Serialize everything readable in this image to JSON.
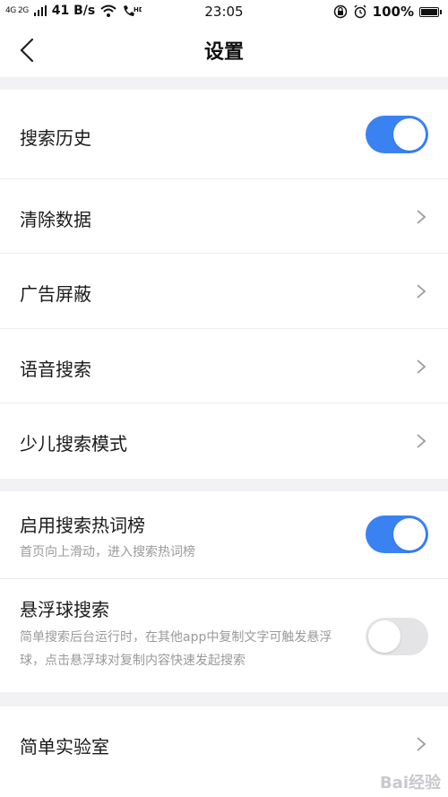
{
  "status_bar": {
    "signal_text": "4G 2G",
    "speed": "41 B/s",
    "time": "23:05",
    "battery": "100%",
    "icons": [
      "signal-icon",
      "wifi-icon",
      "hd-call-icon",
      "rotation-lock-icon",
      "alarm-icon",
      "battery-icon"
    ]
  },
  "nav": {
    "title": "设置",
    "back_icon": "chevron-left-icon"
  },
  "group1": {
    "search_history": {
      "label": "搜索历史",
      "toggle": true
    },
    "clear_data": {
      "label": "清除数据"
    },
    "ad_block": {
      "label": "广告屏蔽"
    },
    "voice_search": {
      "label": "语音搜索"
    },
    "kids_mode": {
      "label": "少儿搜索模式"
    }
  },
  "group2": {
    "hot_list": {
      "label": "启用搜索热词榜",
      "desc": "首页向上滑动，进入搜索热词榜",
      "toggle": true
    },
    "floating_ball": {
      "label": "悬浮球搜索",
      "desc": "简单搜索后台运行时，在其他app中复制文字可触发悬浮球，点击悬浮球对复制内容快速发起搜索",
      "toggle": false
    }
  },
  "group3": {
    "lab": {
      "label": "简单实验室"
    }
  },
  "colors": {
    "accent": "#3a82f2",
    "background": "#f2f2f4",
    "toggle_off": "#e4e4e6"
  },
  "watermark": "Bai经验"
}
